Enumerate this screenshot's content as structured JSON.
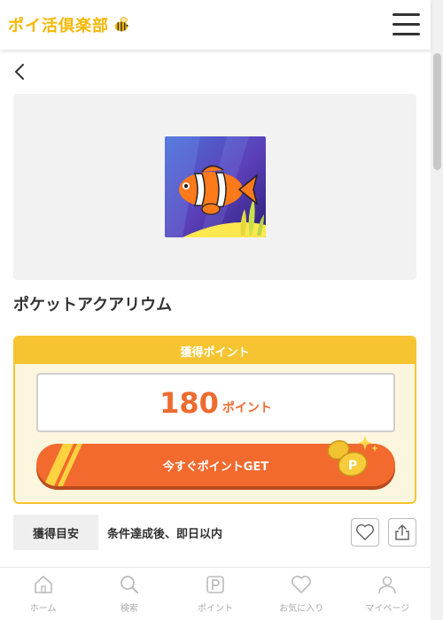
{
  "header": {
    "logo_text": "ポイ活倶楽部",
    "logo_icon": "bee-icon",
    "menu_icon": "hamburger-menu-icon"
  },
  "nav": {
    "back_icon": "chevron-left-icon"
  },
  "app": {
    "name": "ポケットアクアリウム",
    "icon": "clownfish-app-icon"
  },
  "points": {
    "header_label": "獲得ポイント",
    "value": "180",
    "unit": "ポイント",
    "cta_label": "今すぐポイントGET"
  },
  "estimate": {
    "label": "獲得目安",
    "value": "条件達成後、即日以内"
  },
  "bottom_nav": [
    {
      "label": "ホーム",
      "icon": "home-icon"
    },
    {
      "label": "検索",
      "icon": "search-icon"
    },
    {
      "label": "ポイント",
      "icon": "point-icon"
    },
    {
      "label": "お気に入り",
      "icon": "heart-icon"
    },
    {
      "label": "マイページ",
      "icon": "person-icon"
    }
  ],
  "colors": {
    "brand_yellow": "#f6c430",
    "accent_orange": "#f26a2e",
    "logo_yellow": "#f5b700"
  }
}
